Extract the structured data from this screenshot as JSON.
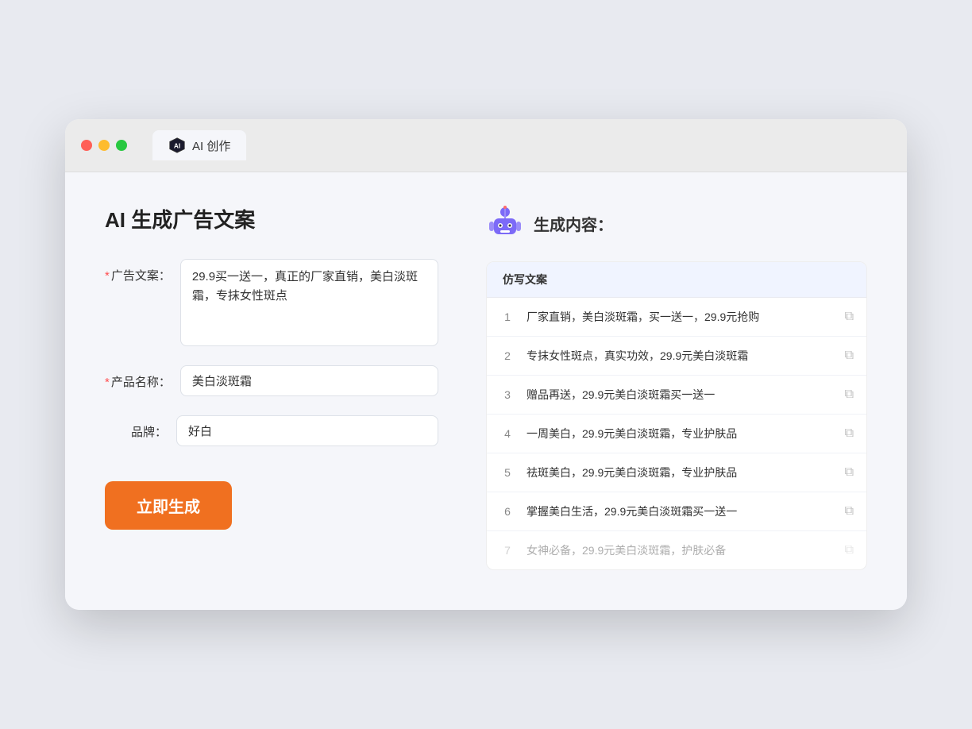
{
  "browser": {
    "tab_title": "AI 创作"
  },
  "page": {
    "title": "AI 生成广告文案"
  },
  "form": {
    "ad_copy_label": "广告文案：",
    "ad_copy_required": "*",
    "ad_copy_value": "29.9买一送一，真正的厂家直销，美白淡斑霜，专抹女性斑点",
    "product_name_label": "产品名称：",
    "product_name_required": "*",
    "product_name_value": "美白淡斑霜",
    "brand_label": "品牌：",
    "brand_value": "好白",
    "generate_btn_label": "立即生成"
  },
  "result": {
    "title": "生成内容：",
    "table_header": "仿写文案",
    "items": [
      {
        "num": "1",
        "text": "厂家直销，美白淡斑霜，买一送一，29.9元抢购",
        "faded": false
      },
      {
        "num": "2",
        "text": "专抹女性斑点，真实功效，29.9元美白淡斑霜",
        "faded": false
      },
      {
        "num": "3",
        "text": "赠品再送，29.9元美白淡斑霜买一送一",
        "faded": false
      },
      {
        "num": "4",
        "text": "一周美白，29.9元美白淡斑霜，专业护肤品",
        "faded": false
      },
      {
        "num": "5",
        "text": "祛斑美白，29.9元美白淡斑霜，专业护肤品",
        "faded": false
      },
      {
        "num": "6",
        "text": "掌握美白生活，29.9元美白淡斑霜买一送一",
        "faded": false
      },
      {
        "num": "7",
        "text": "女神必备，29.9元美白淡斑霜，护肤必备",
        "faded": true
      }
    ]
  }
}
